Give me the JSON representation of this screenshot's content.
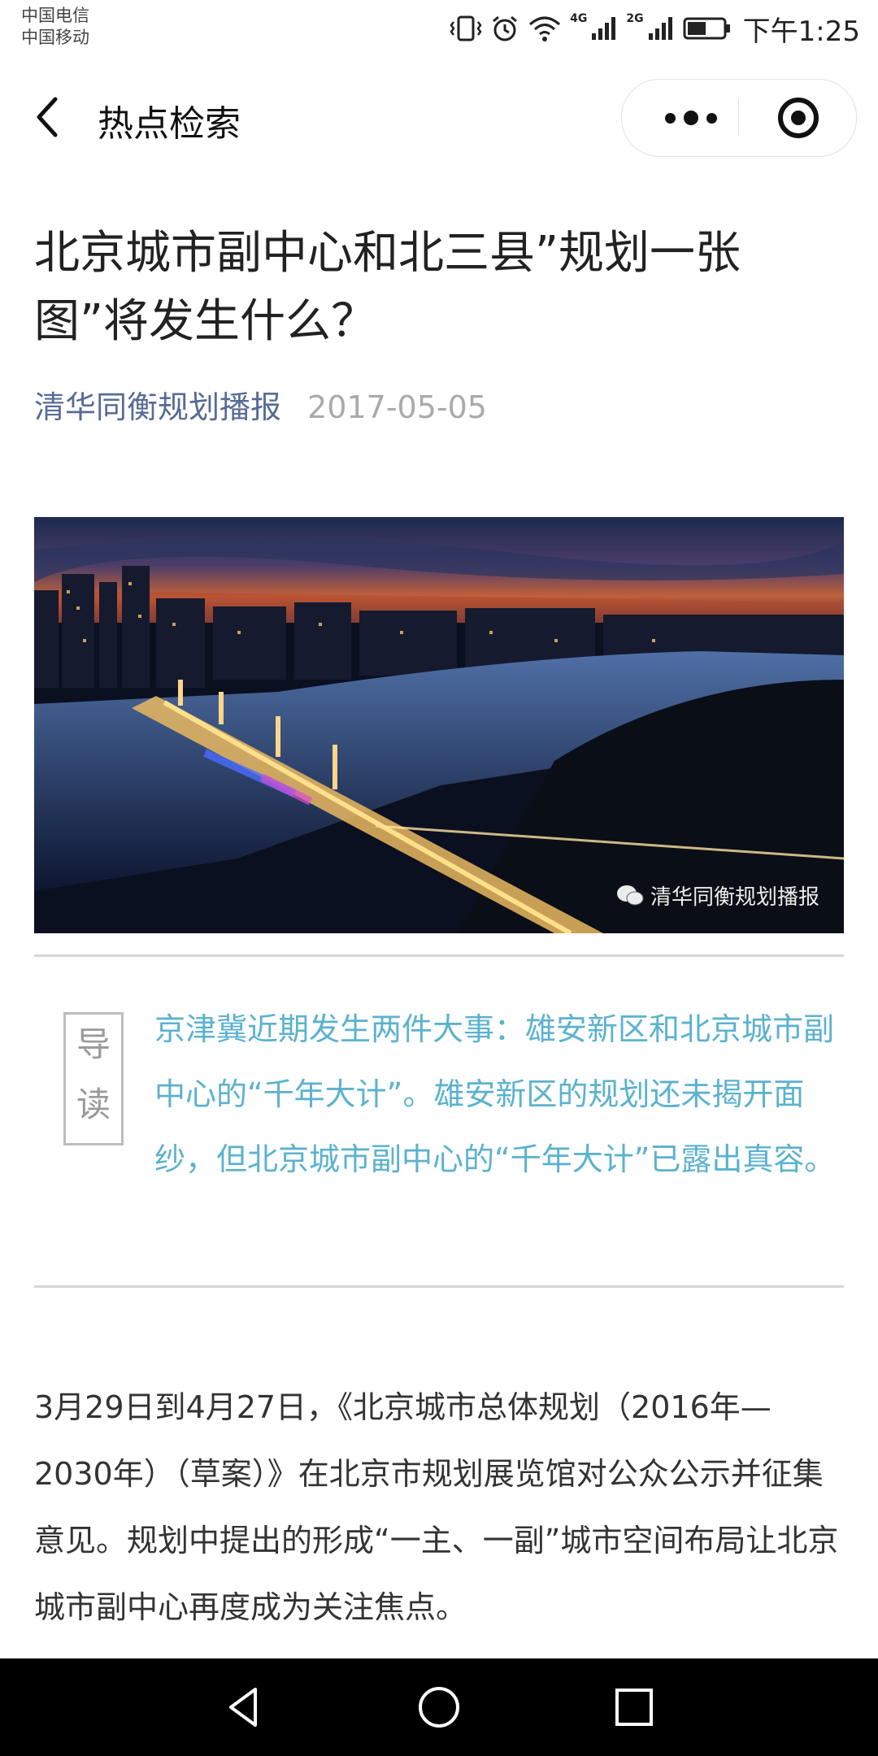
{
  "status_bar": {
    "carrier1": "中国电信",
    "carrier2": "中国移动",
    "net1": "4G",
    "net2": "2G",
    "time": "下午1:25"
  },
  "nav": {
    "title": "热点检索"
  },
  "article": {
    "title": "北京城市副中心和北三县”规划一张图”将发生什么？",
    "source": "清华同衡规划播报",
    "date": "2017-05-05",
    "image_watermark": "清华同衡规划播报",
    "guide_label_1": "导",
    "guide_label_2": "读",
    "intro": "京津冀近期发生两件大事：雄安新区和北京城市副中心的“千年大计”。雄安新区的规划还未揭开面纱，但北京城市副中心的“千年大计”已露出真容。",
    "body": "  3月29日到4月27日，《北京城市总体规划（2016年—2030年）（草案）》在北京市规划展览馆对公众公示并征集意见。规划中提出的形成“一主、一副”城市空间布局让北京城市副中心再度成为关注焦点。"
  },
  "colors": {
    "source_link": "#576b95",
    "intro_text": "#5bb2cf",
    "system_nav": "#000000"
  },
  "icons": [
    "back-icon",
    "more-icon",
    "target-icon",
    "vibrate-icon",
    "alarm-icon",
    "wifi-icon",
    "signal-icon",
    "battery-icon",
    "wechat-icon",
    "nav-back-icon",
    "nav-home-icon",
    "nav-recent-icon"
  ]
}
